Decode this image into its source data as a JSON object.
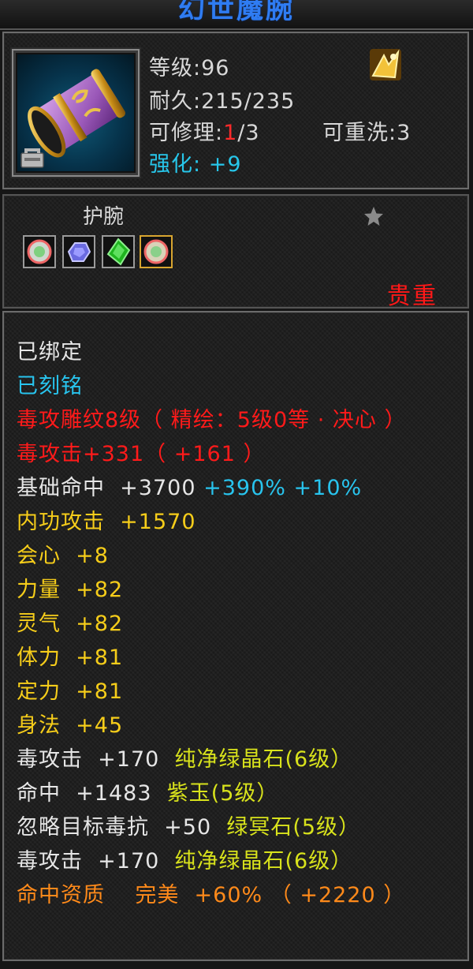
{
  "item": {
    "name": "幻世魔腕",
    "level_label": "等级:",
    "level": "96",
    "durability_label": "耐久:",
    "durability": "215/235",
    "repair_label": "可修理:",
    "repair_used": "1",
    "repair_total": "/3",
    "rewash_label": "可重洗:",
    "rewash": "3",
    "enhance_label": "强化:",
    "enhance": "+9",
    "type": "护腕",
    "rarity": "贵重"
  },
  "colors": {
    "title": "#2f7cf2",
    "cyan": "#28c4ee",
    "red": "#ff1a1a",
    "yellow": "#f6cd1a",
    "orange": "#ff8a1a"
  },
  "icons": [
    "bracer-item-icon",
    "lock-icon",
    "gold-emblem-icon",
    "star-icon",
    "gem-socket-white-icon",
    "gem-socket-blue-icon",
    "gem-socket-green-icon",
    "gem-socket-gold-icon"
  ],
  "stats": {
    "bound": "已绑定",
    "engraved": "已刻铭",
    "engraving": "毒攻雕纹8级（ 精绘：5级0等 · 决心 ）",
    "poison_attack": {
      "label": "毒攻击",
      "value": "+331",
      "bonus": "（ +161 ）"
    },
    "accuracy": {
      "label": "基础命中",
      "value": "+3700",
      "bonus1": "+390%",
      "bonus2": "+10%"
    },
    "internal_attack": {
      "label": "内功攻击",
      "value": "+1570"
    },
    "crit": {
      "label": "会心",
      "value": "+8"
    },
    "strength": {
      "label": "力量",
      "value": "+82"
    },
    "spirit": {
      "label": "灵气",
      "value": "+82"
    },
    "stamina": {
      "label": "体力",
      "value": "+81"
    },
    "focus": {
      "label": "定力",
      "value": "+81"
    },
    "agility": {
      "label": "身法",
      "value": "+45"
    }
  },
  "gems": [
    {
      "label": "毒攻击",
      "value": "+170",
      "gem": "纯净绿晶石",
      "level": "(6级）"
    },
    {
      "label": "命中",
      "value": "+1483",
      "gem": "紫玉",
      "level": "(5级）"
    },
    {
      "label": "忽略目标毒抗",
      "value": "+50",
      "gem": "绿冥石",
      "level": "(5级）"
    },
    {
      "label": "毒攻击",
      "value": "+170",
      "gem": "纯净绿晶石",
      "level": "(6级）"
    }
  ],
  "quality": {
    "label": "命中资质",
    "grade": "完美",
    "percent": "+60%",
    "bonus": "（ +2220 ）"
  }
}
